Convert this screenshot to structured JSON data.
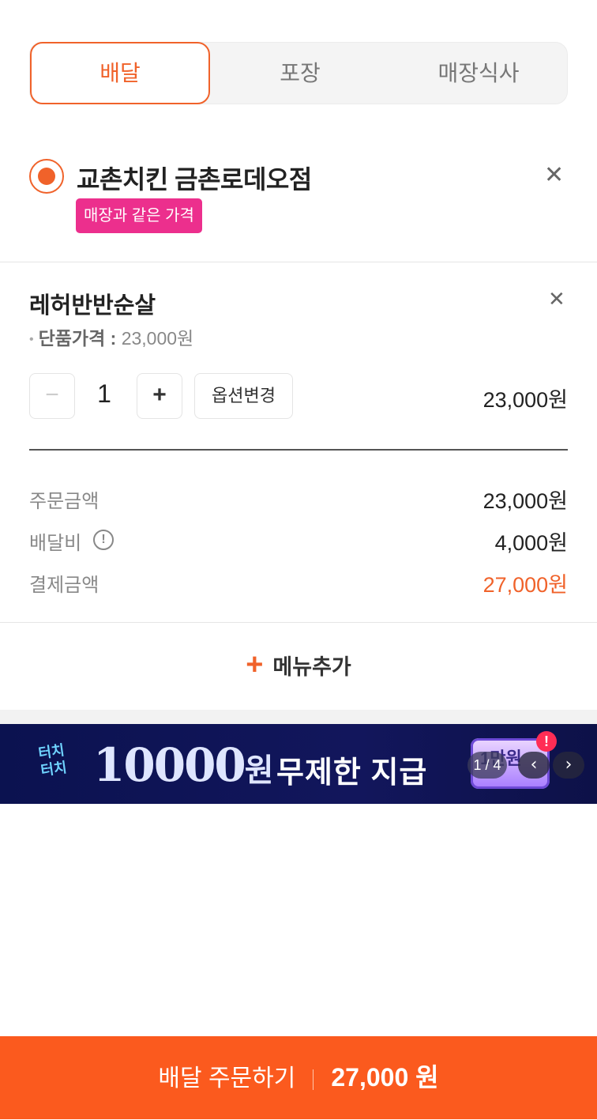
{
  "tabs": [
    {
      "label": "배달",
      "selected": true
    },
    {
      "label": "포장",
      "selected": false
    },
    {
      "label": "매장식사",
      "selected": false
    }
  ],
  "store": {
    "name": "교촌치킨 금촌로데오점",
    "badge": "매장과 같은 가격",
    "close_icon": "close-icon"
  },
  "item": {
    "name": "레허반반순살",
    "unit_price_label": "단품가격 :",
    "unit_price_value": "23,000원",
    "quantity": "1",
    "minus": "−",
    "plus": "+",
    "option_button": "옵션변경",
    "total": "23,000원"
  },
  "summary": {
    "order_amount_label": "주문금액",
    "order_amount_value": "23,000원",
    "delivery_fee_label": "배달비",
    "delivery_fee_value": "4,000원",
    "payment_label": "결제금액",
    "payment_value": "27,000원"
  },
  "add_menu": {
    "plus": "+",
    "label": "메뉴추가"
  },
  "banner": {
    "touch_text_1": "터치",
    "touch_text_2": "터치",
    "amount": "10000",
    "amount_unit": "원",
    "headline": "무제한 지급",
    "card_text": "1만원",
    "alert": "!",
    "counter": "1 / 4"
  },
  "cta": {
    "label": "배달 주문하기",
    "amount": "27,000 원"
  },
  "colors": {
    "accent": "#f0622a",
    "cta_bg": "#fb5a1e",
    "badge_bg": "#ec2f8d",
    "banner_bg": "#0b1250"
  }
}
